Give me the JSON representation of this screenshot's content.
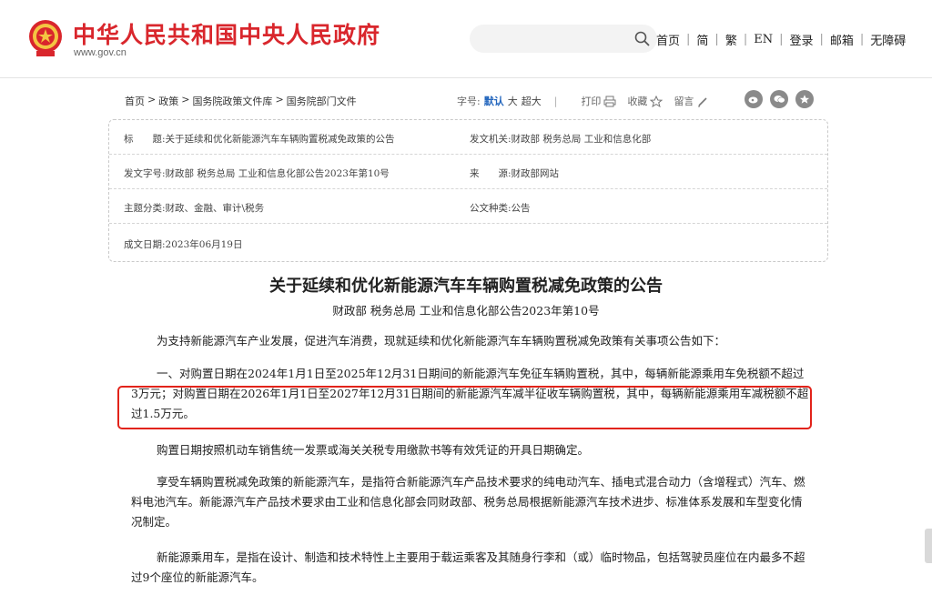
{
  "header": {
    "site_title": "中华人民共和国中央人民政府",
    "site_url": "www.gov.cn",
    "search_placeholder": "",
    "nav": [
      "首页",
      "简",
      "繁",
      "EN",
      "登录",
      "邮箱",
      "无障碍"
    ]
  },
  "breadcrumb": {
    "items": [
      "首页",
      "政策",
      "国务院政策文件库",
      "国务院部门文件"
    ],
    "separator": ">"
  },
  "tools": {
    "font_label": "字号:",
    "size_default": "默认",
    "size_large": "大",
    "size_xlarge": "超大",
    "print": "打印",
    "favorite": "收藏",
    "comment": "留言"
  },
  "info": {
    "title_label": "标　　题:",
    "title_value": "关于延续和优化新能源汽车车辆购置税减免政策的公告",
    "issuer_label": "发文机关:",
    "issuer_value": "财政部  税务总局  工业和信息化部",
    "doc_no_label": "发文字号:",
    "doc_no_value": "财政部 税务总局 工业和信息化部公告2023年第10号",
    "source_label": "来　　源:",
    "source_value": "财政部网站",
    "topic_label": "主题分类:",
    "topic_value": "财政、金融、审计\\税务",
    "type_label": "公文种类:",
    "type_value": "公告",
    "date_label": "成文日期:",
    "date_value": "2023年06月19日"
  },
  "article": {
    "title": "关于延续和优化新能源汽车车辆购置税减免政策的公告",
    "subtitle": "财政部 税务总局 工业和信息化部公告2023年第10号",
    "p1": "为支持新能源汽车产业发展，促进汽车消费，现就延续和优化新能源汽车车辆购置税减免政策有关事项公告如下：",
    "p2": "一、对购置日期在2024年1月1日至2025年12月31日期间的新能源汽车免征车辆购置税，其中，每辆新能源乘用车免税额不超过3万元；对购置日期在2026年1月1日至2027年12月31日期间的新能源汽车减半征收车辆购置税，其中，每辆新能源乘用车减税额不超过1.5万元。",
    "p3": "购置日期按照机动车销售统一发票或海关关税专用缴款书等有效凭证的开具日期确定。",
    "p4": "享受车辆购置税减免政策的新能源汽车，是指符合新能源汽车产品技术要求的纯电动汽车、插电式混合动力（含增程式）汽车、燃料电池汽车。新能源汽车产品技术要求由工业和信息化部会同财政部、税务总局根据新能源汽车技术进步、标准体系发展和车型变化情况制定。",
    "p5": "新能源乘用车，是指在设计、制造和技术特性上主要用于载运乘客及其随身行李和（或）临时物品，包括驾驶员座位在内最多不超过9个座位的新能源汽车。"
  },
  "colors": {
    "brand_red": "#d9262c",
    "highlight": "#e2231a",
    "active_size": "#2366bd"
  }
}
